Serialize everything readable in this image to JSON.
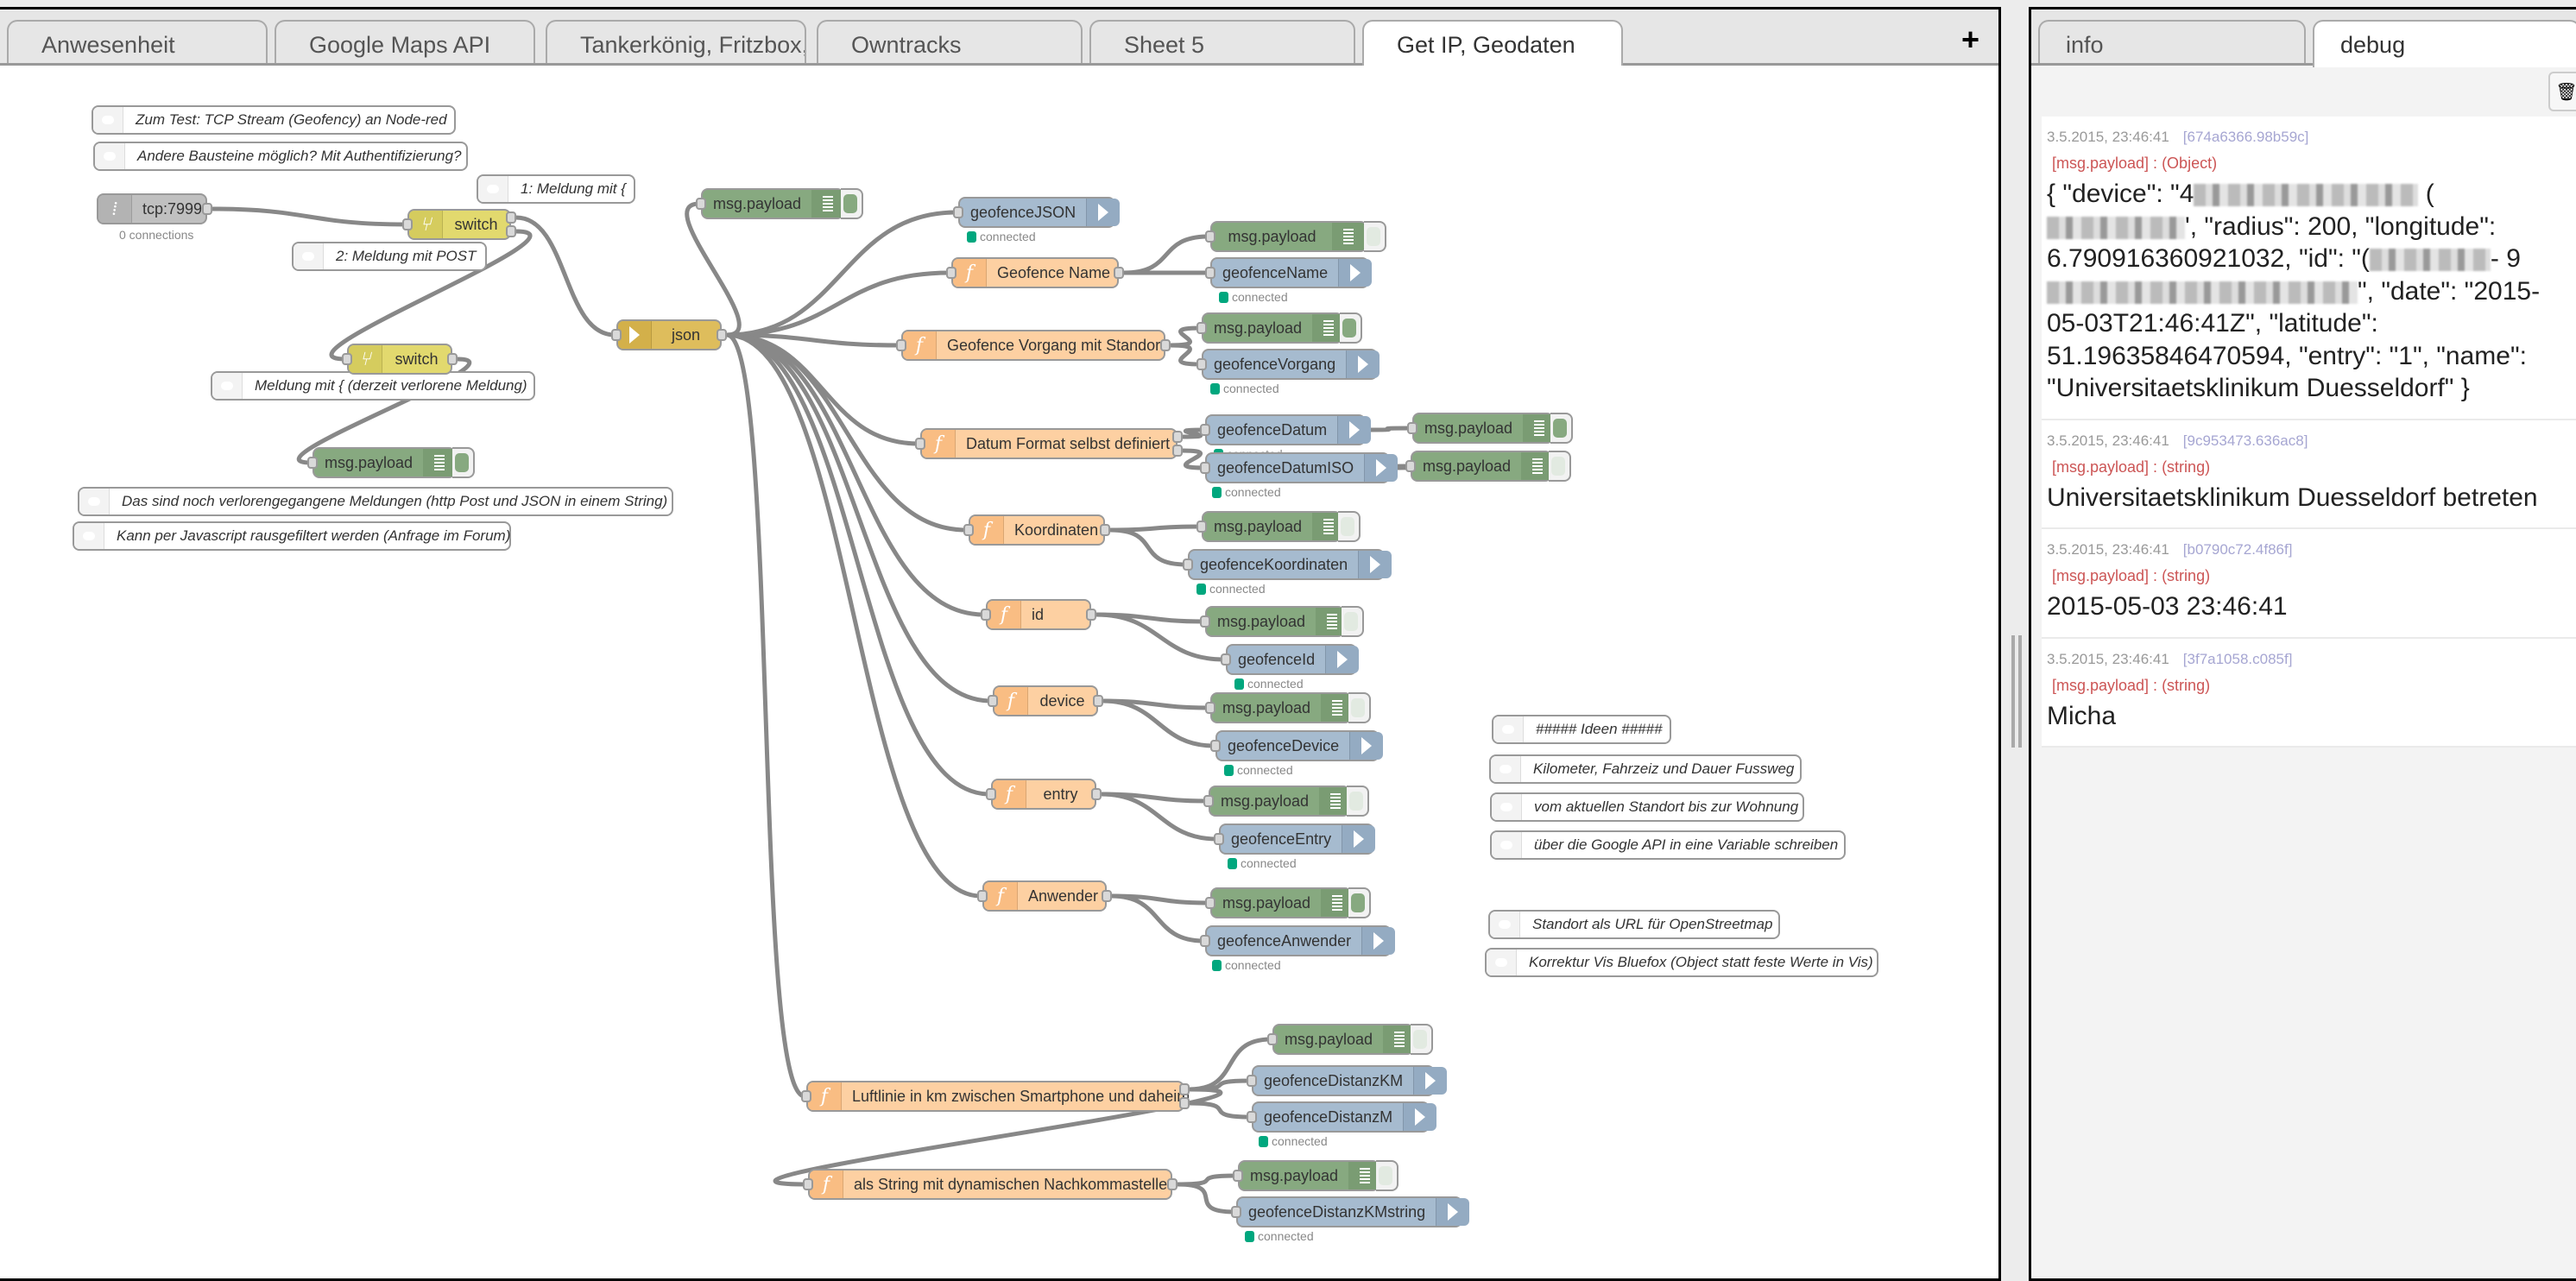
{
  "workspace": {
    "tabs": [
      {
        "label": "Anwesenheit",
        "active": false
      },
      {
        "label": "Google Maps API",
        "active": false
      },
      {
        "label": "Tankerkönig, Fritzbox, \\",
        "active": false
      },
      {
        "label": "Owntracks",
        "active": false
      },
      {
        "label": "Sheet 5",
        "active": false
      },
      {
        "label": "Get IP, Geodaten",
        "active": true
      }
    ],
    "add_tab_icon": "+"
  },
  "nodes": {
    "tcp": {
      "label": "tcp:7999",
      "status": "0 connections"
    },
    "switch1": {
      "label": "switch"
    },
    "switch2": {
      "label": "switch"
    },
    "json": {
      "label": "json"
    },
    "debug_top": {
      "label": "msg.payload"
    },
    "debug_switch": {
      "label": "msg.payload"
    },
    "geofenceJSON": {
      "label": "geofenceJSON",
      "status": "connected"
    },
    "fn_name": {
      "label": "Geofence Name"
    },
    "debug_name": {
      "label": "msg.payload"
    },
    "geofenceName": {
      "label": "geofenceName",
      "status": "connected"
    },
    "fn_vorgang": {
      "label": "Geofence Vorgang mit Standort"
    },
    "debug_vorgang": {
      "label": "msg.payload"
    },
    "geofenceVorgang": {
      "label": "geofenceVorgang",
      "status": "connected"
    },
    "fn_datum": {
      "label": "Datum Format selbst definiert"
    },
    "geofenceDatum": {
      "label": "geofenceDatum",
      "status": "connected"
    },
    "geofenceDatumISO": {
      "label": "geofenceDatumISO",
      "status": "connected"
    },
    "debug_datum": {
      "label": "msg.payload"
    },
    "debug_datumiso": {
      "label": "msg.payload"
    },
    "fn_koord": {
      "label": "Koordinaten"
    },
    "debug_koord": {
      "label": "msg.payload"
    },
    "geofenceKoordinaten": {
      "label": "geofenceKoordinaten",
      "status": "connected"
    },
    "fn_id": {
      "label": "id"
    },
    "debug_id": {
      "label": "msg.payload"
    },
    "geofenceId": {
      "label": "geofenceId",
      "status": "connected"
    },
    "fn_device": {
      "label": "device"
    },
    "debug_device": {
      "label": "msg.payload"
    },
    "geofenceDevice": {
      "label": "geofenceDevice",
      "status": "connected"
    },
    "fn_entry": {
      "label": "entry"
    },
    "debug_entry": {
      "label": "msg.payload"
    },
    "geofenceEntry": {
      "label": "geofenceEntry",
      "status": "connected"
    },
    "fn_anwender": {
      "label": "Anwender"
    },
    "debug_anwender": {
      "label": "msg.payload"
    },
    "geofenceAnwender": {
      "label": "geofenceAnwender",
      "status": "connected"
    },
    "fn_luftlinie": {
      "label": "Luftlinie in km zwischen Smartphone und daheim"
    },
    "debug_luftlinie": {
      "label": "msg.payload"
    },
    "geofenceDistanzKM": {
      "label": "geofenceDistanzKM",
      "status": "connected"
    },
    "geofenceDistanzM": {
      "label": "geofenceDistanzM",
      "status": "connected"
    },
    "fn_string": {
      "label": "als String mit dynamischen Nachkommastellen"
    },
    "debug_string": {
      "label": "msg.payload"
    },
    "geofenceDistanzKMstring": {
      "label": "geofenceDistanzKMstring",
      "status": "connected"
    }
  },
  "comments": [
    "Zum Test: TCP Stream (Geofency) an Node-red",
    "Andere Bausteine möglich? Mit Authentifizierung?",
    "1: Meldung mit {",
    "2: Meldung mit POST",
    "Meldung mit { (derzeit verlorene Meldung)",
    "Das sind noch verlorengegangene Meldungen (http Post und JSON in einem String)",
    "Kann per Javascript rausgefiltert werden (Anfrage im Forum)",
    "##### Ideen #####",
    "Kilometer, Fahrzeiz und Dauer Fussweg",
    "vom aktuellen Standort bis zur Wohnung",
    "über die Google API in eine Variable schreiben",
    "Standort als URL für OpenStreetmap",
    "Korrektur Vis Bluefox (Object statt feste Werte in Vis)"
  ],
  "sidebar": {
    "tabs": [
      {
        "label": "info",
        "active": false
      },
      {
        "label": "debug",
        "active": true
      }
    ],
    "clear_icon": "trash-icon",
    "messages": [
      {
        "timestamp": "3.5.2015, 23:46:41",
        "source": "[674a6366.98b59c]",
        "topic": "[msg.payload] : (Object)",
        "payload_parts": {
          "p1": "{ \"device\": \"4",
          "p2": "(",
          "p3": "', \"radius\": 200, \"longitude\": 6.790916360921032, \"id\": \"(",
          "p4": "-",
          "p5": "9",
          "p6": "\", \"date\": \"2015-05-03T21:46:41Z\", \"latitude\": 51.19635846470594, \"entry\": \"1\", \"name\": \"Universitaetsklinikum Duesseldorf\" }"
        }
      },
      {
        "timestamp": "3.5.2015, 23:46:41",
        "source": "[9c953473.636ac8]",
        "topic": "[msg.payload] : (string)",
        "payload": "Universitaetsklinikum Duesseldorf betreten"
      },
      {
        "timestamp": "3.5.2015, 23:46:41",
        "source": "[b0790c72.4f86f]",
        "topic": "[msg.payload] : (string)",
        "payload": "2015-05-03 23:46:41"
      },
      {
        "timestamp": "3.5.2015, 23:46:41",
        "source": "[3f7a1058.c085f]",
        "topic": "[msg.payload] : (string)",
        "payload": "Micha"
      }
    ]
  }
}
